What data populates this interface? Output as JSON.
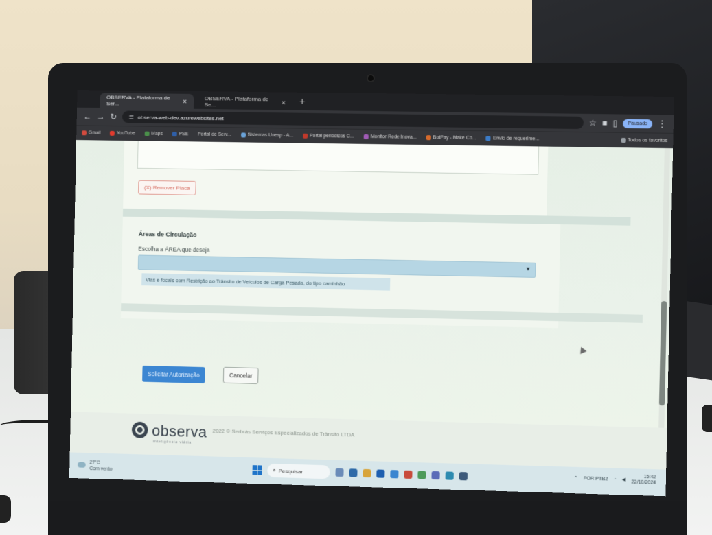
{
  "browser": {
    "tabs": [
      {
        "label": "OBSERVA - Plataforma de Ser...",
        "active": true
      },
      {
        "label": "OBSERVA - Plataforma de Se...",
        "active": false
      }
    ],
    "url": "observa-web-dev.azurewebsites.net",
    "profile_label": "Pausado",
    "bookmarks": [
      {
        "label": "Gmail",
        "color": "#d24b3e"
      },
      {
        "label": "YouTube",
        "color": "#e23b2e"
      },
      {
        "label": "Maps",
        "color": "#4a8f4a"
      },
      {
        "label": "PSE",
        "color": "#2f5fa8"
      },
      {
        "label": "Portal de Serv...",
        "color": "#4f7fc6"
      },
      {
        "label": "Sistemas Unesp - A...",
        "color": "#6aa2d8"
      },
      {
        "label": "Portal periódicos C...",
        "color": "#c0392b"
      },
      {
        "label": "Monitor Rede Inova...",
        "color": "#a05bb5"
      },
      {
        "label": "BotPay - Make Co...",
        "color": "#d66a2c"
      },
      {
        "label": "Envio de requerime...",
        "color": "#3b7bc6"
      },
      {
        "label": "Todos os favoritos",
        "color": "#9aa0a6"
      }
    ]
  },
  "form": {
    "remove_plate_label": "(X) Remover Placa",
    "areas_title": "Áreas de Circulação",
    "area_select_label": "Escolha a ÁREA que deseja",
    "area_selected_value": "Vias e focais com Restrição ao Trânsito de Veículos de Carga Pesada, do tipo caminhão",
    "submit_label": "Solicitar Autorização",
    "cancel_label": "Cancelar"
  },
  "footer": {
    "logo_text": "observa",
    "logo_tagline": "inteligência viária",
    "copyright": "2022 © Serbrás Serviços Especializados de Trânsito LTDA"
  },
  "taskbar": {
    "weather_temp": "27°C",
    "weather_desc": "Com vento",
    "search_label": "Pesquisar",
    "language": "POR PTB2",
    "time": "15:42",
    "date": "22/10/2024"
  },
  "colors": {
    "primary": "#3c86d2",
    "danger": "#d66a5e",
    "select_bg": "#b6d6e4",
    "page_bg": "#eaf2ea"
  }
}
